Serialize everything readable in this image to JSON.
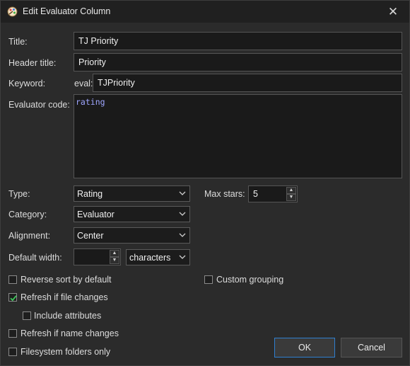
{
  "window": {
    "title": "Edit Evaluator Column",
    "close_glyph": "✕",
    "app_icon": "evaluator-palette-icon"
  },
  "form": {
    "title_label": "Title:",
    "title_value": "TJ Priority",
    "header_title_label": "Header title:",
    "header_title_value": "Priority",
    "keyword_label": "Keyword:",
    "keyword_prefix": "eval:",
    "keyword_value": "TJPriority",
    "code_label": "Evaluator code:",
    "code_value": "rating",
    "type_label": "Type:",
    "type_value": "Rating",
    "max_stars_label": "Max stars:",
    "max_stars_value": "5",
    "category_label": "Category:",
    "category_value": "Evaluator",
    "alignment_label": "Alignment:",
    "alignment_value": "Center",
    "default_width_label": "Default width:",
    "default_width_value": "",
    "width_unit_value": "characters"
  },
  "checkboxes": {
    "reverse_sort": {
      "label": "Reverse sort by default",
      "checked": false
    },
    "custom_grouping": {
      "label": "Custom grouping",
      "checked": false
    },
    "refresh_file": {
      "label": "Refresh if file changes",
      "checked": true
    },
    "include_attributes": {
      "label": "Include attributes",
      "checked": false
    },
    "refresh_name": {
      "label": "Refresh if name changes",
      "checked": false
    },
    "folders_only": {
      "label": "Filesystem folders only",
      "checked": false
    }
  },
  "buttons": {
    "ok": "OK",
    "cancel": "Cancel"
  },
  "colors": {
    "accent": "#2f7fd0",
    "code_text": "#9fa6ff",
    "check_mark": "#3cc85a"
  }
}
